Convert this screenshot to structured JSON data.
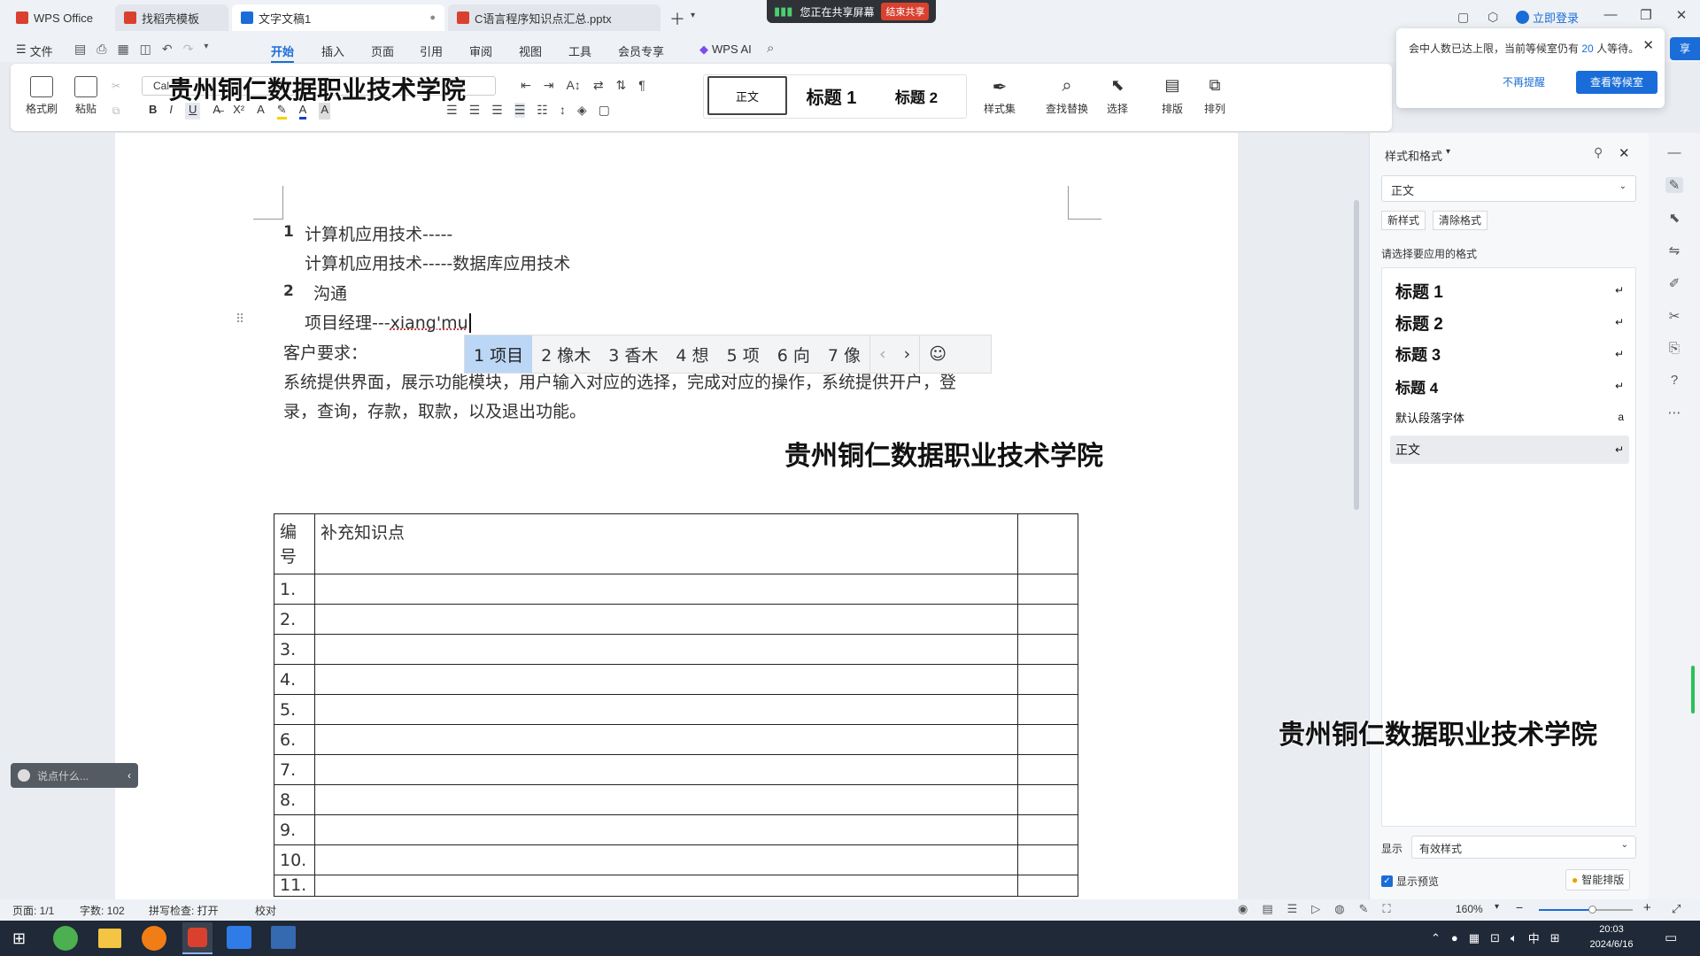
{
  "tabs": [
    {
      "label": "WPS Office",
      "icon": "wps-icon",
      "color": "#d9412e"
    },
    {
      "label": "找稻壳模板",
      "icon": "docer-icon",
      "color": "#d9412e"
    },
    {
      "label": "文字文稿1",
      "icon": "writer-icon",
      "color": "#1a6dd8"
    },
    {
      "label": "C语言程序知识点汇总.pptx",
      "icon": "ppt-icon",
      "color": "#d9412e"
    }
  ],
  "share": {
    "text": "您正在共享屏幕",
    "stop": "结束共享"
  },
  "account": {
    "login": "立即登录"
  },
  "menu": {
    "file": "文件",
    "items": [
      "开始",
      "插入",
      "页面",
      "引用",
      "审阅",
      "视图",
      "工具",
      "会员专享"
    ],
    "ai": "WPS AI"
  },
  "ribbon": {
    "format_painter": "格式刷",
    "paste": "粘贴",
    "font": "Cal",
    "styles": [
      "正文",
      "标题 1",
      "标题 2"
    ],
    "style_set": "样式集",
    "find_replace": "查找替换",
    "select": "选择",
    "layout": "排版",
    "arrange": "排列"
  },
  "notice": {
    "text": "会中人数已达上限，当前等候室仍有",
    "count": "20",
    "text2": "人等待。",
    "dismiss": "不再提醒",
    "view": "查看等候室",
    "share_tag": "享"
  },
  "document": {
    "line1_num": "1",
    "line1": "计算机应用技术-----",
    "line2": "计算机应用技术-----数据库应用技术",
    "line3_num": "2",
    "line3": "沟通",
    "line4_prefix": "项目经理---",
    "line4_typing": "xiang'mu",
    "line5": "客户要求：",
    "line6": "系统提供界面，展示功能模块，用户输入对应的选择，完成对应的操作，系统提供开户，登",
    "line7": "录，查询，存款，取款，以及退出功能。",
    "table_header": [
      "编号",
      "补充知识点",
      ""
    ],
    "table_rows": [
      "1.",
      "2.",
      "3.",
      "4.",
      "5.",
      "6.",
      "7.",
      "8.",
      "9.",
      "10.",
      "11."
    ]
  },
  "ime": {
    "candidates": [
      "1 项目",
      "2 橡木",
      "3 香木",
      "4 想",
      "5 项",
      "6 向",
      "7 像"
    ],
    "selected_index": 0
  },
  "watermarks": [
    "贵州铜仁数据职业技术学院",
    "贵州铜仁数据职业技术学院",
    "贵州铜仁数据职业技术学院"
  ],
  "voice": {
    "placeholder": "说点什么..."
  },
  "panel": {
    "title": "样式和格式",
    "current_style": "正文",
    "new_style": "新样式",
    "clear_format": "清除格式",
    "prompt": "请选择要应用的格式",
    "styles": [
      "标题 1",
      "标题 2",
      "标题 3",
      "标题 4",
      "默认段落字体",
      "正文"
    ],
    "show_label": "显示",
    "show_value": "有效样式",
    "preview": "显示预览",
    "smart_layout": "智能排版"
  },
  "status": {
    "page": "页面: 1/1",
    "words": "字数: 102",
    "spell": "拼写检查: 打开",
    "proof": "校对",
    "zoom": "160%"
  },
  "taskbar": {
    "time": "20:03",
    "date": "2024/6/16",
    "ime_lang": "中"
  }
}
